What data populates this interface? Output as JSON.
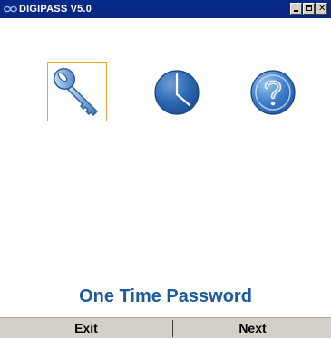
{
  "window": {
    "title": "DIGIPASS V5.0",
    "controls": [
      "minimize-icon",
      "maximize-icon",
      "close-icon"
    ]
  },
  "toolbar": {
    "items": [
      {
        "icon": "key-icon",
        "selected": true
      },
      {
        "icon": "clock-icon",
        "selected": false
      },
      {
        "icon": "help-icon",
        "selected": false
      }
    ]
  },
  "main": {
    "mode_label": "One Time Password"
  },
  "softkeys": {
    "left_label": "Exit",
    "right_label": "Next"
  },
  "colors": {
    "titlebar": "#0a2a8a",
    "accent_blue": "#1d5aa0",
    "selection_border": "#f0a030",
    "softkey_bar": "#d4d0c8"
  }
}
